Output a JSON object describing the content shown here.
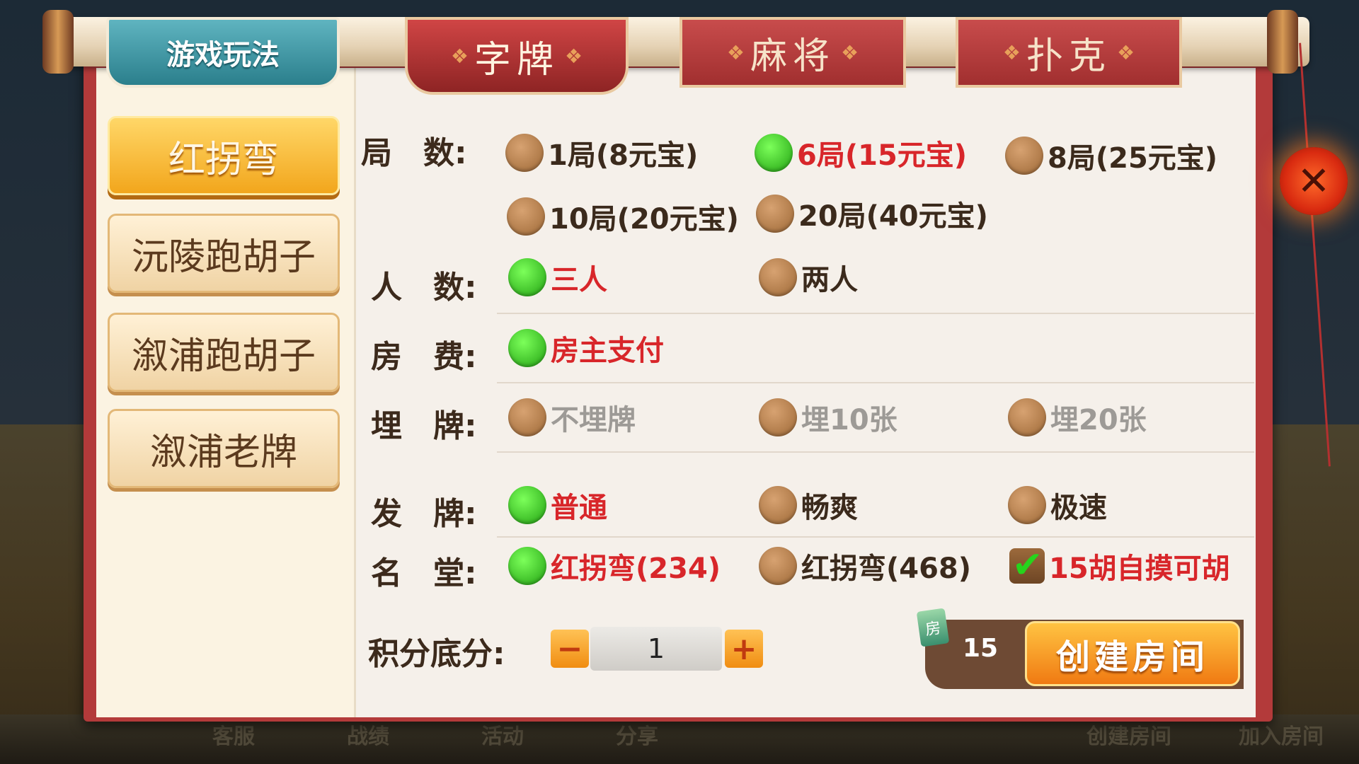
{
  "tabs": {
    "rules": "游戏玩法",
    "zipai": "字牌",
    "majiang": "麻将",
    "poker": "扑克"
  },
  "sidebar": {
    "items": [
      {
        "label": "红拐弯",
        "active": true
      },
      {
        "label": "沅陵跑胡子",
        "active": false
      },
      {
        "label": "溆浦跑胡子",
        "active": false
      },
      {
        "label": "溆浦老牌",
        "active": false
      }
    ]
  },
  "settings": {
    "rounds": {
      "label": "局　数:",
      "options": [
        "1局(8元宝)",
        "6局(15元宝)",
        "8局(25元宝)",
        "10局(20元宝)",
        "20局(40元宝)"
      ],
      "selected": "6局(15元宝)"
    },
    "players": {
      "label": "人　数:",
      "options": [
        "三人",
        "两人"
      ],
      "selected": "三人"
    },
    "fee": {
      "label": "房　费:",
      "options": [
        "房主支付"
      ],
      "selected": "房主支付"
    },
    "bury": {
      "label": "埋　牌:",
      "options": [
        "不埋牌",
        "埋10张",
        "埋20张"
      ],
      "selected": null
    },
    "deal": {
      "label": "发　牌:",
      "options": [
        "普通",
        "畅爽",
        "极速"
      ],
      "selected": "普通"
    },
    "mingtang": {
      "label": "名　堂:",
      "options": [
        "红拐弯(234)",
        "红拐弯(468)"
      ],
      "selected": "红拐弯(234)",
      "checkbox": {
        "label": "15胡自摸可胡",
        "checked": true
      }
    },
    "base_score": {
      "label": "积分底分:",
      "value": "1",
      "minus": "−",
      "plus": "+"
    }
  },
  "footer": {
    "room_card_count": "15",
    "room_card_icon_text": "房",
    "create_label": "创建房间"
  },
  "background_bar": {
    "items": [
      "客服",
      "战绩",
      "活动",
      "分享",
      "创建房间",
      "加入房间"
    ]
  },
  "close_glyph": "✕",
  "colors": {
    "accent_red": "#d8262a",
    "selected_green": "#20a010",
    "create_orange": "#f07a12"
  }
}
